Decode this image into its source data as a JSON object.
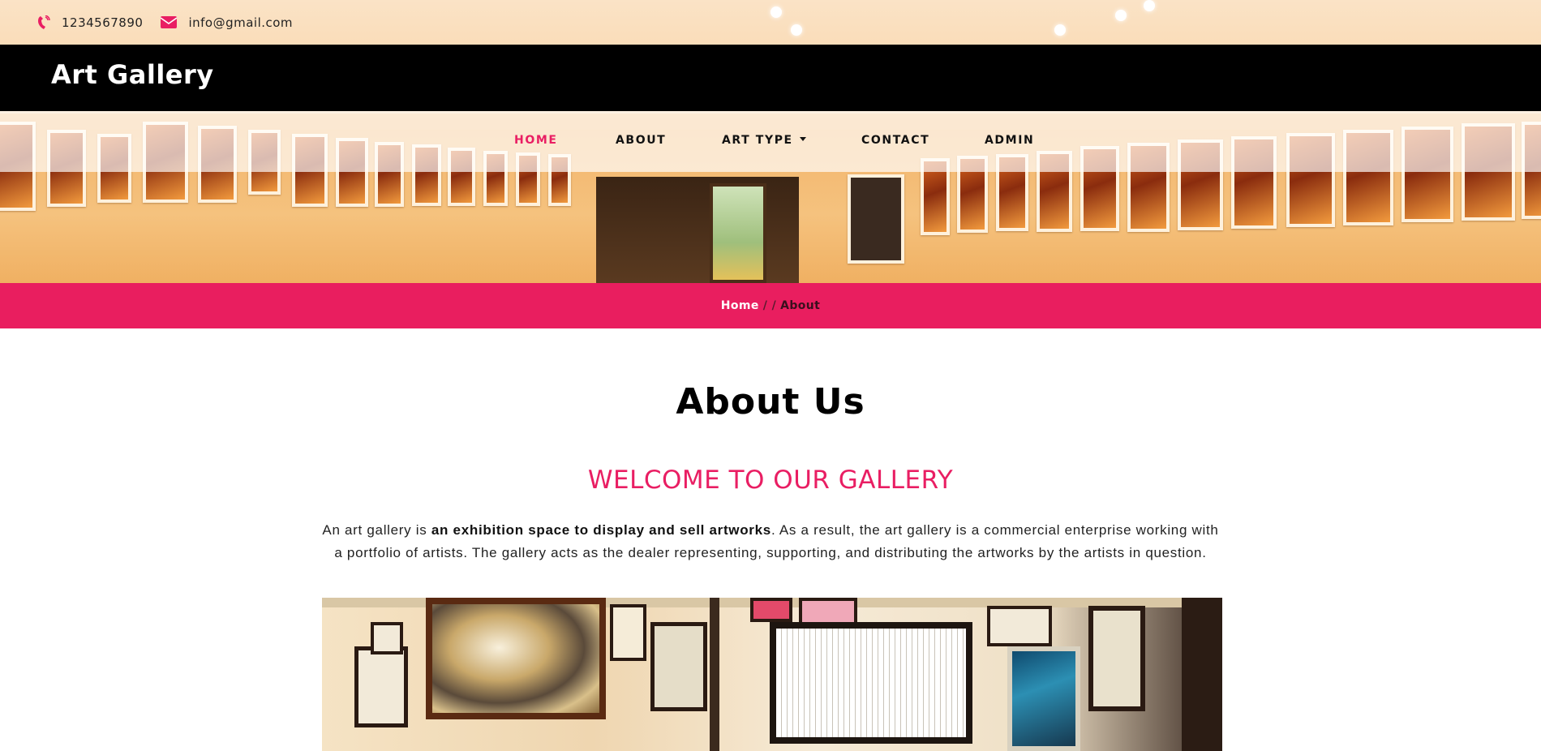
{
  "contact": {
    "phone": "1234567890",
    "email": "info@gmail.com"
  },
  "brand": {
    "name": "Art Gallery"
  },
  "nav": {
    "items": [
      {
        "label": "HOME",
        "active": true
      },
      {
        "label": "ABOUT",
        "active": false
      },
      {
        "label": "ART TYPE",
        "active": false,
        "dropdown": true
      },
      {
        "label": "CONTACT",
        "active": false
      },
      {
        "label": "ADMIN",
        "active": false
      }
    ]
  },
  "breadcrumb": {
    "home": "Home",
    "separator": "/ /",
    "current": "About"
  },
  "about": {
    "title": "About Us",
    "subtitle": "WELCOME TO OUR GALLERY",
    "intro_before": "An art gallery is ",
    "intro_bold": "an exhibition space to display and sell artworks",
    "intro_after": ". As a result, the art gallery is a commercial enterprise working with a portfolio of artists. The gallery acts as the dealer representing, supporting, and distributing the artworks by the artists in question."
  },
  "colors": {
    "accent": "#e91e63",
    "brand_bar": "#000000",
    "breadcrumb_bar": "#e91e5f"
  },
  "icons": {
    "phone": "phone-icon",
    "email": "envelope-icon",
    "dropdown": "caret-down-icon"
  }
}
